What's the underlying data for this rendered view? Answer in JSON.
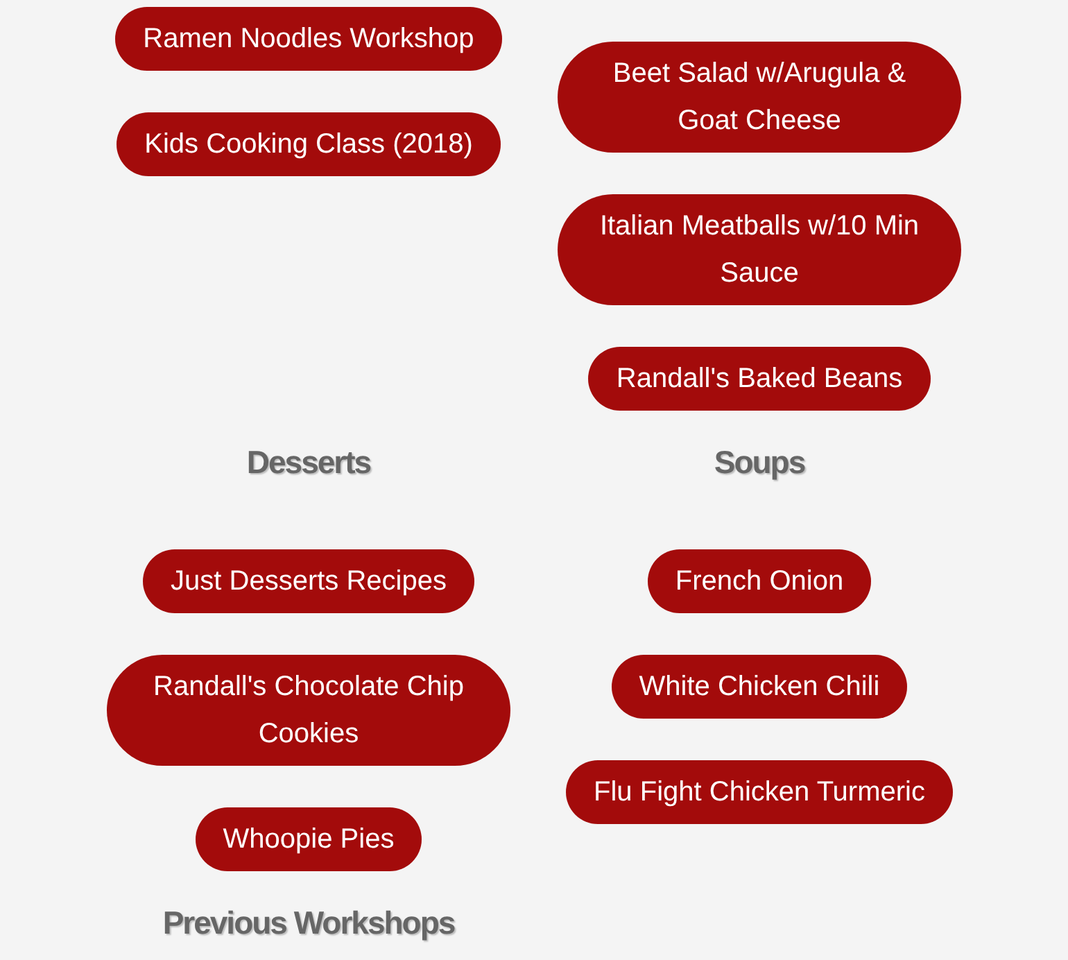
{
  "rows": [
    {
      "cells": [
        {
          "items": [
            {
              "kind": "button",
              "label": "Ramen Noodles Workshop"
            },
            {
              "kind": "button",
              "label": "Kids Cooking Class (2018)"
            }
          ]
        },
        {
          "items": [
            {
              "kind": "button",
              "label": "Beet Salad w/Arugula & Goat Cheese"
            },
            {
              "kind": "button",
              "label": "Italian Meatballs w/10 Min Sauce"
            },
            {
              "kind": "button",
              "label": "Randall's Baked Beans"
            }
          ]
        }
      ]
    },
    {
      "cells": [
        {
          "items": [
            {
              "kind": "heading",
              "label": "Desserts"
            },
            {
              "kind": "button",
              "label": "Just Desserts Recipes"
            },
            {
              "kind": "button",
              "label": "Randall's Chocolate Chip Cookies"
            },
            {
              "kind": "button",
              "label": "Whoopie Pies"
            }
          ]
        },
        {
          "items": [
            {
              "kind": "heading",
              "label": "Soups"
            },
            {
              "kind": "button",
              "label": "French Onion"
            },
            {
              "kind": "button",
              "label": "White Chicken Chili"
            },
            {
              "kind": "button",
              "label": "Flu Fight Chicken Turmeric"
            }
          ]
        }
      ]
    },
    {
      "cells": [
        {
          "items": [
            {
              "kind": "heading",
              "label": "Previous Workshops"
            }
          ]
        }
      ]
    }
  ]
}
